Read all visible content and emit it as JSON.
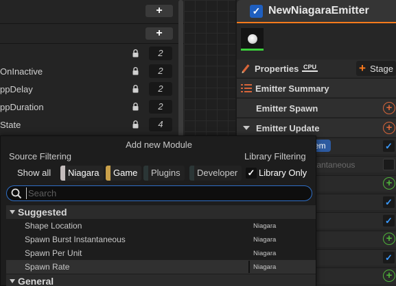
{
  "left_panel": {
    "rows": [
      {
        "name": "OnInactive",
        "value": "2"
      },
      {
        "name": "ppDelay",
        "value": "2"
      },
      {
        "name": "ppDuration",
        "value": "2"
      },
      {
        "name": "State",
        "value": "4"
      }
    ],
    "first_value": "2",
    "add_label": "+",
    "glyphs": [
      "s",
      "S",
      "e",
      "c",
      "o",
      "o"
    ]
  },
  "emitter": {
    "title": "NewNiagaraEmitter",
    "enabled_check": "✓",
    "properties_label": "Properties",
    "sim_target": "CPU",
    "stage_plus": "+",
    "stage_label": "Stage",
    "emitter_summary": "Emitter Summary",
    "emitter_spawn": "Emitter Spawn",
    "emitter_update": "Emitter Update",
    "plus": "+",
    "check": "✓",
    "pill_text": "em",
    "ghost_text": "tantaneous"
  },
  "popup": {
    "title": "Add new Module",
    "source_filtering": "Source Filtering",
    "library_filtering": "Library Filtering",
    "show_all": "Show all",
    "chips": [
      {
        "label": "Niagara",
        "color": "#c4bdbd"
      },
      {
        "label": "Game",
        "color": "#c9a04a"
      },
      {
        "label": "Plugins",
        "color": "#2b3636"
      },
      {
        "label": "Developer",
        "color": "#2b3636"
      }
    ],
    "library_only_label": "Library Only",
    "library_only_check": "✓",
    "search_placeholder": "Search",
    "categories": {
      "suggested": "Suggested",
      "general": "General"
    },
    "items": [
      {
        "name": "Shape Location",
        "source": "Niagara"
      },
      {
        "name": "Spawn Burst Instantaneous",
        "source": "Niagara"
      },
      {
        "name": "Spawn Per Unit",
        "source": "Niagara"
      },
      {
        "name": "Spawn Rate",
        "source": "Niagara"
      }
    ]
  },
  "colors": {
    "accent_orange": "#ff7b1c",
    "search_focus": "#2f6fc7",
    "checkbox_blue": "#1f5fbf",
    "green_plus": "#4fb43a",
    "orange_plus": "#d9663a"
  }
}
